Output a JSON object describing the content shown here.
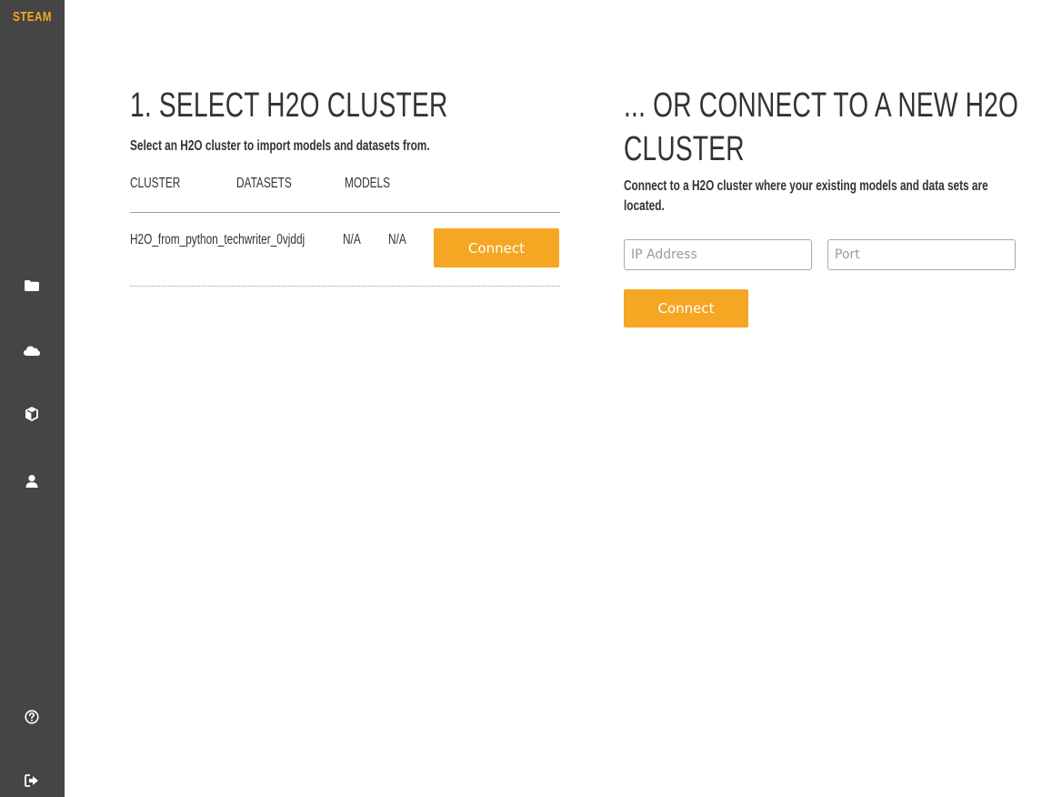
{
  "app": {
    "logo_text": "STEAM",
    "accent_color": "#f5a623",
    "sidebar_color": "#454545"
  },
  "sidebar": {
    "items": [
      {
        "icon": "folder-icon"
      },
      {
        "icon": "cloud-icon"
      },
      {
        "icon": "cube-icon"
      },
      {
        "icon": "user-icon"
      }
    ],
    "bottom_items": [
      {
        "icon": "help-icon"
      },
      {
        "icon": "logout-icon"
      }
    ]
  },
  "select_cluster": {
    "title": "1. SELECT H2O CLUSTER",
    "description": "Select an H2O cluster to import models and datasets from.",
    "columns": [
      "CLUSTER",
      "DATASETS",
      "MODELS"
    ],
    "rows": [
      {
        "cluster": "H2O_from_python_techwriter_0vjddj",
        "datasets": "N/A",
        "models": "N/A",
        "action_label": "Connect"
      }
    ]
  },
  "new_cluster": {
    "title_line1": "... OR CONNECT TO A NEW H2O",
    "title_line2": "CLUSTER",
    "description_line1": "Connect to a H2O cluster where your existing models and data sets are",
    "description_line2": "located.",
    "ip_placeholder": "IP Address",
    "ip_value": "",
    "port_placeholder": "Port",
    "port_value": "",
    "connect_label": "Connect"
  }
}
